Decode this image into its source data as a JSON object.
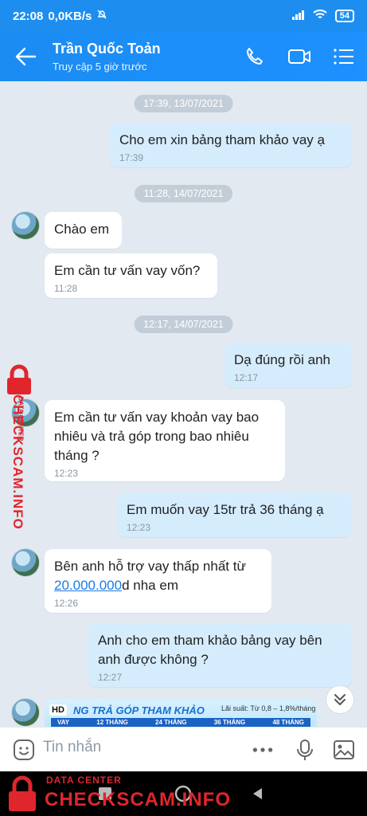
{
  "statusbar": {
    "time": "22:08",
    "speed": "0,0KB/s",
    "battery": "54"
  },
  "header": {
    "name": "Trần Quốc Toản",
    "status": "Truy cập 5 giờ trước"
  },
  "messages": {
    "d1": "17:39, 13/07/2021",
    "m1": {
      "text": "Cho em xin bảng tham khảo vay ạ",
      "time": "17:39"
    },
    "d2": "11:28, 14/07/2021",
    "m2": {
      "text": "Chào em"
    },
    "m3": {
      "text": "Em cần tư vấn vay vốn?",
      "time": "11:28"
    },
    "d3": "12:17, 14/07/2021",
    "m4": {
      "text": "Dạ đúng rồi anh",
      "time": "12:17"
    },
    "m5": {
      "text": "Em cần tư vấn vay khoản vay bao nhiêu và trả góp trong bao nhiêu tháng ?",
      "time": "12:23"
    },
    "m6": {
      "text": "Em muốn vay 15tr trả 36 tháng ạ",
      "time": "12:23"
    },
    "m7": {
      "before": "Bên anh hỗ trợ vay thấp nhất từ ",
      "link": "20.000.000",
      "after": "d nha em",
      "time": "12:26"
    },
    "m8": {
      "text": "Anh cho em tham khảo bảng vay bên anh được không ?",
      "time": "12:27"
    },
    "image": {
      "hd": "HD",
      "title": "NG TRẢ GÓP THAM KHẢO",
      "rate": "Lãi suất:  Từ 0,8 – 1,8%/tháng",
      "columns": [
        "VAY",
        "12 THÁNG",
        "24 THÁNG",
        "36 THÁNG",
        "48 THÁNG"
      ]
    }
  },
  "input": {
    "placeholder": "Tin nhắn"
  },
  "watermark": {
    "small": "DATA CENTER",
    "big": "CHECKSCAM.INFO"
  },
  "colors": {
    "header": "#1d8ef0",
    "outgoing": "#d5ecfd",
    "incoming": "#ffffff",
    "watermark": "#e0262c"
  }
}
